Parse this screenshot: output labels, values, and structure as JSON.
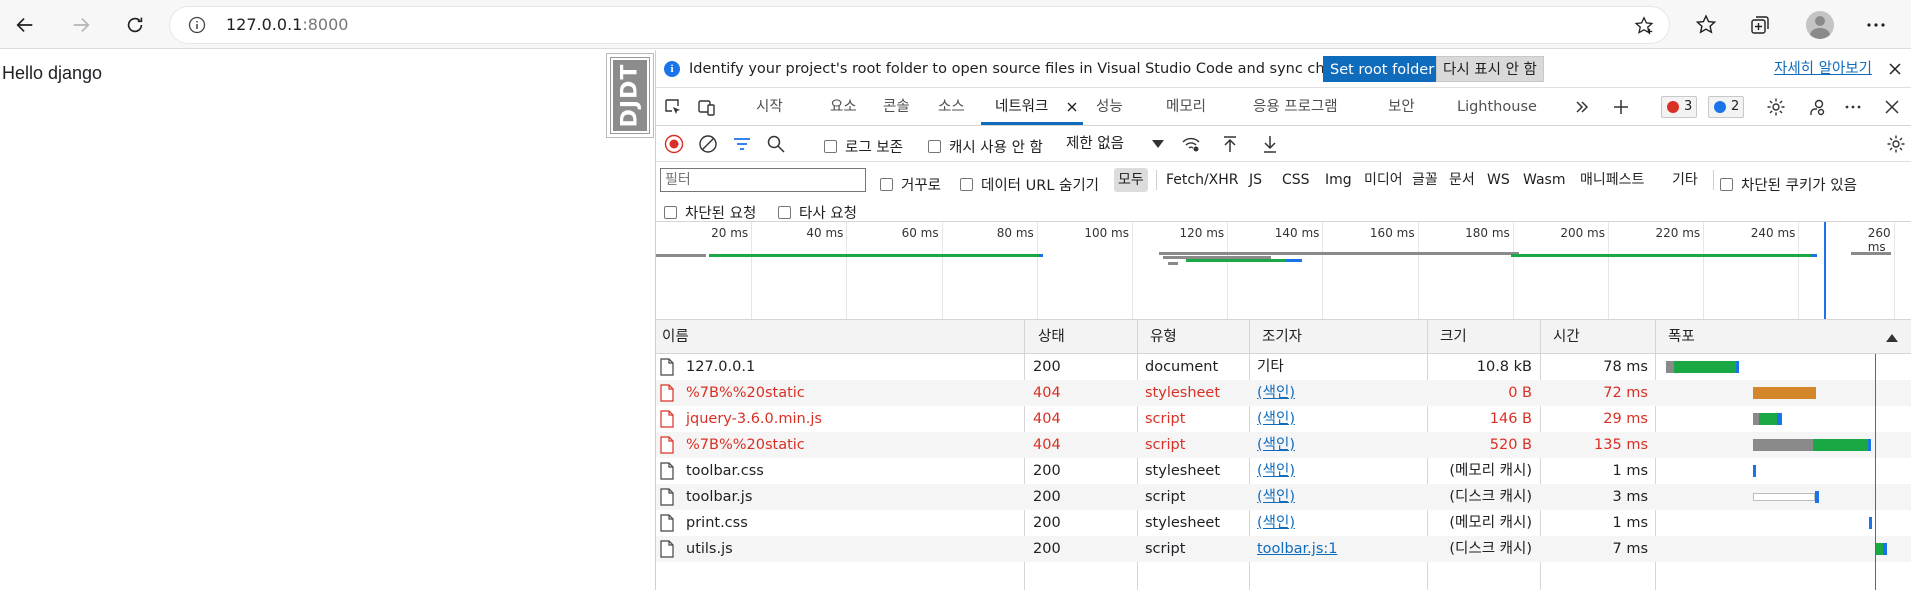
{
  "browser": {
    "url_host": "127.0.0.1",
    "url_port": ":8000"
  },
  "page": {
    "text": "Hello django",
    "djdt_label": "DJDT"
  },
  "devtools": {
    "infobar": {
      "message": "Identify your project's root folder to open source files in Visual Studio Code and sync changes.",
      "set_root_label": "Set root folder",
      "dont_show_label": "다시 표시 안 함",
      "learn_more_label": "자세히 알아보기"
    },
    "tabs": {
      "start": "시작",
      "elements": "요소",
      "console": "콘솔",
      "sources": "소스",
      "network": "네트워크",
      "performance": "성능",
      "memory": "메모리",
      "application": "응용 프로그램",
      "security": "보안",
      "lighthouse": "Lighthouse",
      "error_count": "3",
      "message_count": "2"
    },
    "toolbar": {
      "preserve_log": "로그 보존",
      "disable_cache": "캐시 사용 안 함",
      "throttling": "제한 없음"
    },
    "filter": {
      "placeholder": "필터",
      "invert": "거꾸로",
      "hide_data_urls": "데이터 URL 숨기기",
      "all": "모두",
      "types": [
        "Fetch/XHR",
        "JS",
        "CSS",
        "Img",
        "미디어",
        "글꼴",
        "문서",
        "WS",
        "Wasm",
        "매니페스트",
        "기타"
      ],
      "blocked_cookies": "차단된 쿠키가 있음",
      "blocked_requests": "차단된 요청",
      "third_party": "타사 요청"
    },
    "overview_ticks": [
      "20 ms",
      "40 ms",
      "60 ms",
      "80 ms",
      "100 ms",
      "120 ms",
      "140 ms",
      "160 ms",
      "180 ms",
      "200 ms",
      "220 ms",
      "240 ms",
      "260 ms"
    ],
    "columns": {
      "name": "이름",
      "status": "상태",
      "type": "유형",
      "initiator": "조기자",
      "size": "크기",
      "time": "시간",
      "waterfall": "폭포"
    },
    "requests": [
      {
        "name": "127.0.0.1",
        "status": "200",
        "type": "document",
        "initiator": "기타",
        "size": "10.8 kB",
        "time": "78 ms"
      },
      {
        "name": "%7B%%20static",
        "status": "404",
        "type": "stylesheet",
        "initiator": "(색인)",
        "size": "0 B",
        "time": "72 ms"
      },
      {
        "name": "jquery-3.6.0.min.js",
        "status": "404",
        "type": "script",
        "initiator": "(색인)",
        "size": "146 B",
        "time": "29 ms"
      },
      {
        "name": "%7B%%20static",
        "status": "404",
        "type": "script",
        "initiator": "(색인)",
        "size": "520 B",
        "time": "135 ms"
      },
      {
        "name": "toolbar.css",
        "status": "200",
        "type": "stylesheet",
        "initiator": "(색인)",
        "size": "(메모리 캐시)",
        "time": "1 ms"
      },
      {
        "name": "toolbar.js",
        "status": "200",
        "type": "script",
        "initiator": "(색인)",
        "size": "(디스크 캐시)",
        "time": "3 ms"
      },
      {
        "name": "print.css",
        "status": "200",
        "type": "stylesheet",
        "initiator": "(색인)",
        "size": "(메모리 캐시)",
        "time": "1 ms"
      },
      {
        "name": "utils.js",
        "status": "200",
        "type": "script",
        "initiator": "toolbar.js:1",
        "size": "(디스크 캐시)",
        "time": "7 ms"
      }
    ],
    "colors": {
      "accent": "#0f6cbd",
      "error": "#d93025",
      "waiting": "#8a8a8a",
      "download": "#1aa845",
      "receive": "#1a73e8",
      "stalled": "#d4862a"
    }
  }
}
